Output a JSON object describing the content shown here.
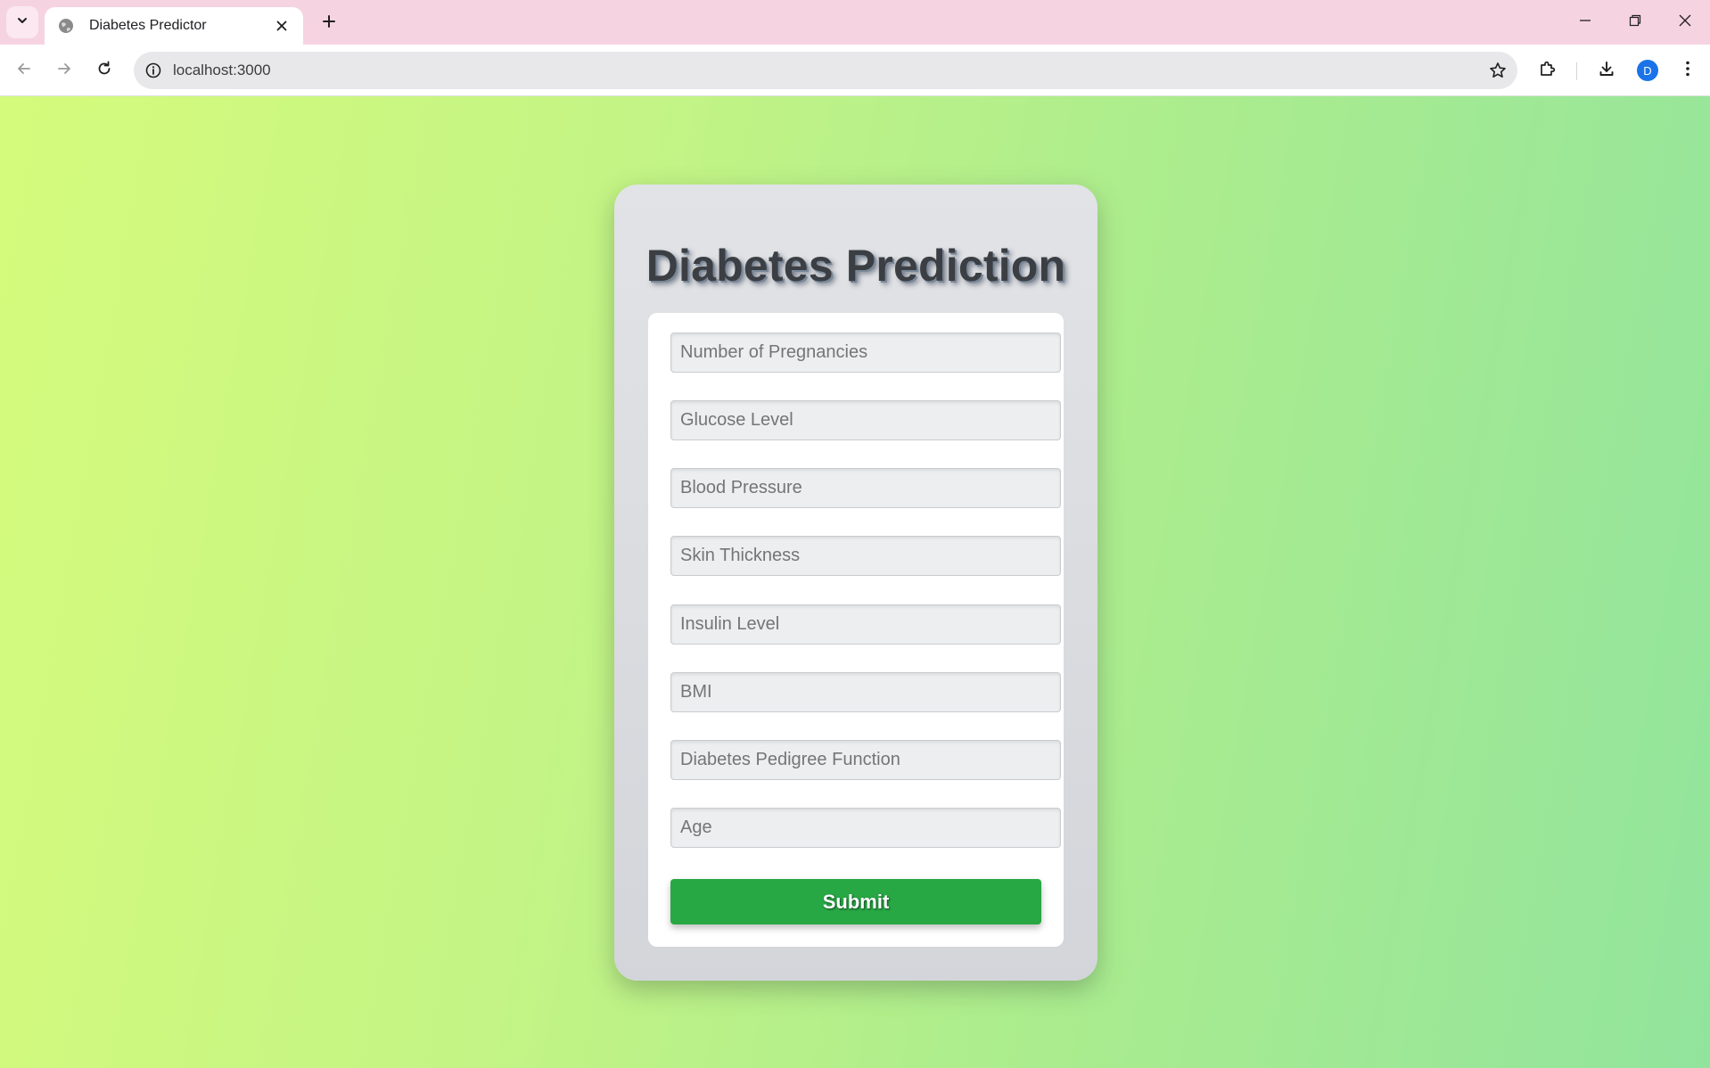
{
  "browser": {
    "tab_title": "Diabetes Predictor",
    "url": "localhost:3000",
    "profile_initial": "D"
  },
  "page": {
    "title": "Diabetes Prediction",
    "fields": [
      {
        "placeholder": "Number of Pregnancies",
        "value": ""
      },
      {
        "placeholder": "Glucose Level",
        "value": ""
      },
      {
        "placeholder": "Blood Pressure",
        "value": ""
      },
      {
        "placeholder": "Skin Thickness",
        "value": ""
      },
      {
        "placeholder": "Insulin Level",
        "value": ""
      },
      {
        "placeholder": "BMI",
        "value": ""
      },
      {
        "placeholder": "Diabetes Pedigree Function",
        "value": ""
      },
      {
        "placeholder": "Age",
        "value": ""
      }
    ],
    "submit_label": "Submit"
  },
  "colors": {
    "tabbar": "#f6d3e1",
    "submit": "#28a745",
    "gradient_start": "#d5fb7c",
    "gradient_end": "#92e49d"
  },
  "icons": {
    "tab_search": "chevron-down-icon",
    "favicon": "globe-icon",
    "close_tab": "close-icon",
    "new_tab": "plus-icon",
    "back": "arrow-left-icon",
    "forward": "arrow-right-icon",
    "reload": "reload-icon",
    "site_info": "info-icon",
    "bookmark": "star-icon",
    "extensions": "puzzle-icon",
    "downloads": "download-icon",
    "menu": "kebab-menu-icon"
  }
}
